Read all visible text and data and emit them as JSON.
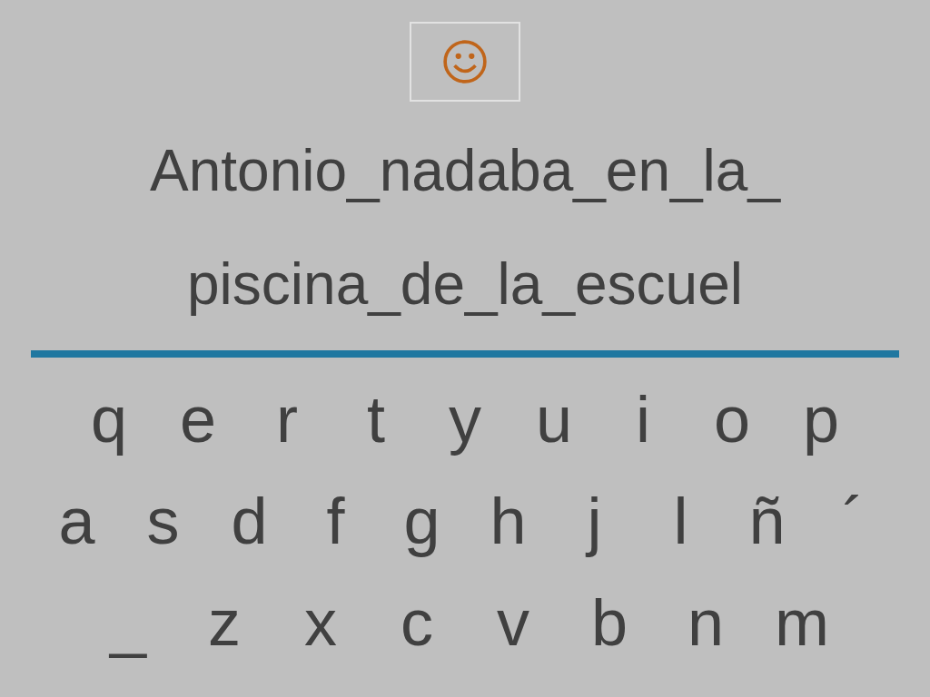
{
  "feedback_box": {
    "kind": "happy"
  },
  "sentence_lines": [
    "Antonio_nadaba_en_la_",
    "piscina_de_la_escuel"
  ],
  "keyboard": {
    "rows": [
      [
        "q",
        "e",
        "r",
        "t",
        "y",
        "u",
        "i",
        "o",
        "p"
      ],
      [
        "a",
        "s",
        "d",
        "f",
        "g",
        "h",
        "j",
        "l",
        "ñ",
        "´"
      ],
      [
        "_",
        "z",
        "x",
        "c",
        "v",
        "b",
        "n",
        "m"
      ]
    ]
  }
}
